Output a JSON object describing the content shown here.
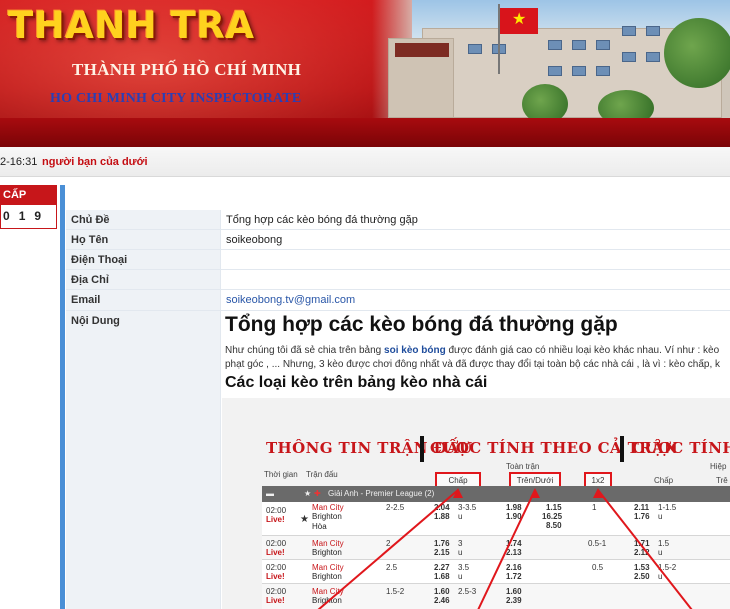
{
  "banner": {
    "logo": "THANH TRA",
    "city_vi": "THÀNH PHỐ HỒ CHÍ MINH",
    "city_en": "HO CHI MINH CITY INSPECTORATE"
  },
  "ticker": {
    "time": "2-16:31",
    "text": "người bạn của dưới"
  },
  "sidebar": {
    "header": "CẤP",
    "counter": [
      "0",
      "1",
      "9"
    ]
  },
  "detail": {
    "rows": [
      {
        "label": "Chủ Đề",
        "value": "Tổng hợp các kèo bóng đá thường gặp"
      },
      {
        "label": "Họ Tên",
        "value": "soikeobong"
      },
      {
        "label": "Điện Thoại",
        "value": ""
      },
      {
        "label": "Địa Chỉ",
        "value": ""
      },
      {
        "label": "Email",
        "value": "soikeobong.tv@gmail.com"
      },
      {
        "label": "Nội Dung",
        "value": ""
      }
    ]
  },
  "content": {
    "title": "Tổng hợp các kèo bóng đá thường gặp",
    "para_1a": "Như chúng tôi đã sẻ chia trên bảng ",
    "para_1_link": "soi kèo bóng",
    "para_1b": " được đánh giá cao có nhiều loại kèo khác nhau. Ví như : kèo",
    "para_2": "phạt góc , ... Nhưng, 3 kèo được chơi đông nhất và đã được thay đổi tại toàn bộ các nhà cái , là vì : kèo chấp, k",
    "subtitle": "Các loại kèo trên bảng kèo nhà cái"
  },
  "odds_image": {
    "head_1": "THÔNG TIN TRẬN ĐẤU",
    "head_2": "CƯỢC TÍNH THEO CẢ TRẬN",
    "head_3": "CƯỢC TÍNH T",
    "col_time": "Thời gian",
    "col_match": "Trận đấu",
    "col_fulltime": "Toàn trận",
    "col_half": "Hiệp",
    "box_chap": "Chấp",
    "box_tren_duoi": "Trên/Dưới",
    "box_1x2": "1x2",
    "col_chap_2": "Chấp",
    "col_tren_2": "Trê",
    "league": "Giải Anh - Premier League (2)",
    "matches": [
      {
        "time": "02:00",
        "live": "Live!",
        "home": "Man City",
        "away": "Brighton",
        "draw": "Hòa",
        "hcap": "2-2.5",
        "hcap_odds_1": "2.04",
        "hcap_odds_2": "1.88",
        "ou": "3-3.5",
        "ou_u": "u",
        "ou_odds_1": "1.98",
        "ou_odds_2": "1.90",
        "x12_1": "1.15",
        "x12_2": "16.25",
        "x12_3": "8.50",
        "h_hcap": "1",
        "h_odds_1": "2.11",
        "h_odds_2": "1.76",
        "h_ou": "1-1.5",
        "h_ou_u": "u"
      },
      {
        "time": "02:00",
        "live": "Live!",
        "home": "Man City",
        "away": "Brighton",
        "draw": "",
        "hcap": "2",
        "hcap_odds_1": "1.76",
        "hcap_odds_2": "2.15",
        "ou": "3",
        "ou_u": "u",
        "ou_odds_1": "1.74",
        "ou_odds_2": "2.13",
        "x12_1": "",
        "x12_2": "",
        "x12_3": "",
        "h_hcap": "0.5-1",
        "h_odds_1": "1.71",
        "h_odds_2": "2.12",
        "h_ou": "1.5",
        "h_ou_u": "u"
      },
      {
        "time": "02:00",
        "live": "Live!",
        "home": "Man City",
        "away": "Brighton",
        "draw": "",
        "hcap": "2.5",
        "hcap_odds_1": "2.27",
        "hcap_odds_2": "1.68",
        "ou": "3.5",
        "ou_u": "u",
        "ou_odds_1": "2.16",
        "ou_odds_2": "1.72",
        "x12_1": "",
        "x12_2": "",
        "x12_3": "",
        "h_hcap": "0.5",
        "h_odds_1": "1.53",
        "h_odds_2": "2.50",
        "h_ou": "1.5-2",
        "h_ou_u": "u"
      },
      {
        "time": "02:00",
        "live": "Live!",
        "home": "Man City",
        "away": "Brighton",
        "draw": "",
        "hcap": "1.5-2",
        "hcap_odds_1": "1.60",
        "hcap_odds_2": "2.46",
        "ou": "2.5-3",
        "ou_u": "u",
        "ou_odds_1": "1.60",
        "ou_odds_2": "2.39",
        "x12_1": "",
        "x12_2": "",
        "x12_3": "",
        "h_hcap": "",
        "h_odds_1": "",
        "h_odds_2": "",
        "h_ou": "",
        "h_ou_u": ""
      }
    ]
  },
  "colors": {
    "brand_red": "#c7161a",
    "logo_yellow": "#ffd21e",
    "link_blue": "#2a57a8",
    "sidebar_divider": "#4a8fd6"
  }
}
